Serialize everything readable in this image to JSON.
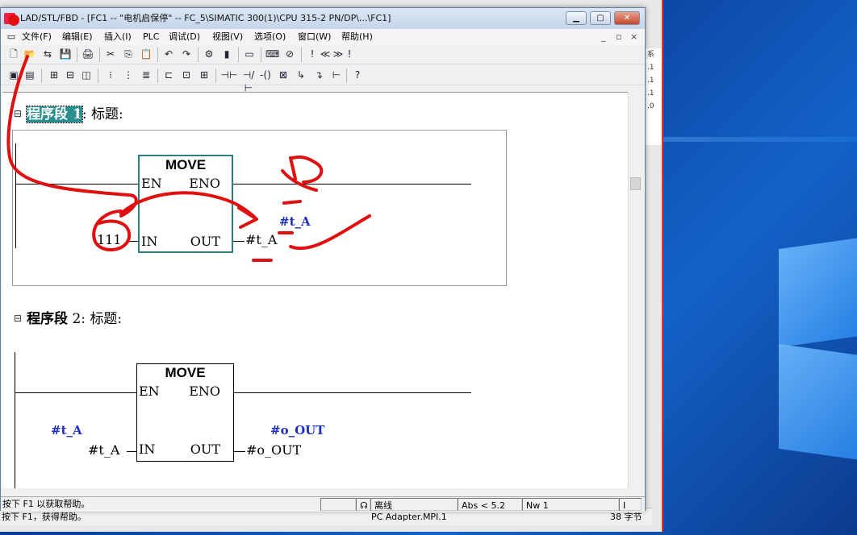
{
  "window": {
    "title": "LAD/STL/FBD  - [FC1 -- \"电机启保停\" -- FC_5\\SIMATIC 300(1)\\CPU 315-2 PN/DP\\...\\FC1]",
    "btn_min": "▁",
    "btn_max": "▢",
    "btn_close": "✕"
  },
  "menu": {
    "items": [
      "文件(F)",
      "编辑(E)",
      "插入(I)",
      "PLC",
      "调试(D)",
      "视图(V)",
      "选项(O)",
      "窗口(W)",
      "帮助(H)"
    ],
    "mdi_min": "_",
    "mdi_restore": "▫",
    "mdi_close": "×"
  },
  "toolbar1": [
    "🗋",
    "📂",
    "⇆",
    "💾",
    "🖨",
    "✂",
    "⎘",
    "📋",
    "↶",
    "↷",
    "⚙",
    "▮",
    "▭",
    "⌨",
    "⊘",
    "!",
    "≪",
    "≫",
    "!"
  ],
  "toolbar2": [
    "▣",
    "▤",
    "⊞",
    "⊟",
    "◫",
    "⁝",
    "⋮",
    "≣",
    "⊏",
    "⊡",
    "⊞",
    "⊣⊢",
    "⊣/⊢",
    "-()",
    "⊠",
    "↳",
    "↴",
    "⊢",
    "?"
  ],
  "networks": [
    {
      "toggle": "⊟",
      "name": "程序段 1",
      "sep": ":",
      "title": "标题:",
      "block": {
        "name": "MOVE",
        "en": "EN",
        "eno": "ENO",
        "in": "IN",
        "out": "OUT"
      },
      "in_value": "111",
      "out_value": "#t_A",
      "out_symbol": "#t_A"
    },
    {
      "toggle": "⊟",
      "name": "程序段",
      "num": "2",
      "sep": ":",
      "title": "标题:",
      "block": {
        "name": "MOVE",
        "en": "EN",
        "eno": "ENO",
        "in": "IN",
        "out": "OUT"
      },
      "in_symbol": "#t_A",
      "in_value": "#t_A",
      "out_symbol": "#o_OUT",
      "out_value": "#o_OUT"
    }
  ],
  "status": {
    "help": "按下 F1 以获取帮助。",
    "mode": "离线",
    "abs": "Abs < 5.2",
    "nw": "Nw 1",
    "insert": "I"
  },
  "back_status": {
    "help": "按下 F1，获得帮助。",
    "adapter": "PC Adapter.MPI.1",
    "count": "38 字节"
  },
  "back_window": {
    "tab_label": "系",
    "values": [
      ".1",
      ".1",
      ".1",
      ".0"
    ]
  },
  "colors": {
    "accent": "#2c8f8f",
    "symbol": "#1f2fc0",
    "annotation": "#e01010"
  }
}
